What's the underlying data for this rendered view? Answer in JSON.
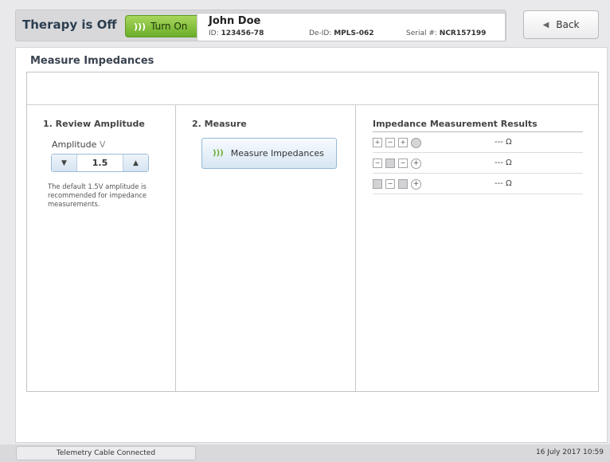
{
  "header": {
    "therapy_status": "Therapy is Off",
    "turn_on_label": "Turn On",
    "patient_name": "John Doe",
    "id_label": "ID:",
    "id_value": "123456-78",
    "deid_label": "De-ID:",
    "deid_value": "MPLS-062",
    "serial_label": "Serial #:",
    "serial_value": "NCR157199",
    "back_label": "Back"
  },
  "page": {
    "title": "Measure Impedances"
  },
  "review": {
    "title": "1. Review Amplitude",
    "amplitude_label": "Amplitude",
    "amplitude_unit": "V",
    "amplitude_value": "1.5",
    "note": "The default 1.5V amplitude is recommended for impedance measurements."
  },
  "measure": {
    "title": "2. Measure",
    "button_label": "Measure Impedances"
  },
  "results": {
    "title": "Impedance Measurement Results",
    "rows": [
      {
        "electrodes": [
          "+",
          "-",
          "+",
          "circle-gray"
        ],
        "value": "--- Ω"
      },
      {
        "electrodes": [
          "-",
          "gray",
          "-",
          "circle-plus"
        ],
        "value": "--- Ω"
      },
      {
        "electrodes": [
          "gray",
          "-",
          "gray",
          "circle-plus"
        ],
        "value": "--- Ω"
      }
    ]
  },
  "footer": {
    "telemetry": "Telemetry Cable Connected",
    "datetime": "16 July 2017 10:59"
  },
  "icons": {
    "wireless": "wireless-icon",
    "back": "back-arrow-icon",
    "down": "down-arrow-icon",
    "up": "up-arrow-icon"
  },
  "colors": {
    "turn_on_green": "#6cae2a",
    "accent_blue": "#96b8d5"
  }
}
